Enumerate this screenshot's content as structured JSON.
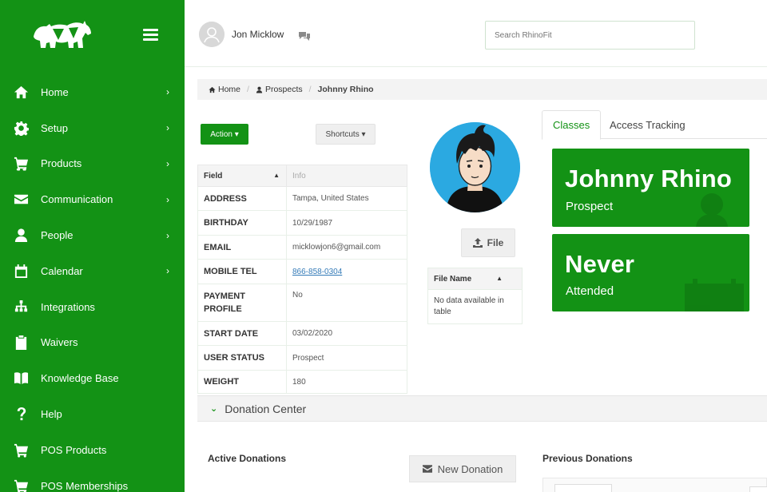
{
  "sidebar": {
    "menu_icon": "hamburger-icon",
    "items": [
      {
        "label": "Home",
        "icon": "home-icon",
        "chevron": true
      },
      {
        "label": "Setup",
        "icon": "gear-icon",
        "chevron": true
      },
      {
        "label": "Products",
        "icon": "cart-icon",
        "chevron": true
      },
      {
        "label": "Communication",
        "icon": "envelope-icon",
        "chevron": true
      },
      {
        "label": "People",
        "icon": "person-icon",
        "chevron": true
      },
      {
        "label": "Calendar",
        "icon": "calendar-icon",
        "chevron": true
      },
      {
        "label": "Integrations",
        "icon": "sitemap-icon",
        "chevron": false
      },
      {
        "label": "Waivers",
        "icon": "clipboard-icon",
        "chevron": false
      },
      {
        "label": "Knowledge Base",
        "icon": "book-icon",
        "chevron": false
      },
      {
        "label": "Help",
        "icon": "question-icon",
        "chevron": false
      },
      {
        "label": "POS Products",
        "icon": "cart-icon",
        "chevron": false
      },
      {
        "label": "POS Memberships",
        "icon": "cart-icon",
        "chevron": false
      }
    ],
    "chevron": "›"
  },
  "header": {
    "user_name": "Jon Micklow",
    "search_placeholder": "Search RhinoFit"
  },
  "breadcrumb": {
    "home": "Home",
    "prospects": "Prospects",
    "current": "Johnny Rhino",
    "sep": "/"
  },
  "actions": {
    "action_label": "Action ▾",
    "shortcuts_label": "Shortcuts ▾"
  },
  "fields": {
    "header_field": "Field",
    "header_sort": "▲",
    "header_info": "Info",
    "rows": [
      {
        "key": "ADDRESS",
        "value": "Tampa, United States"
      },
      {
        "key": "BIRTHDAY",
        "value": "10/29/1987"
      },
      {
        "key": "EMAIL",
        "value": "micklowjon6@gmail.com"
      },
      {
        "key": "MOBILE TEL",
        "value": "866-858-0304"
      },
      {
        "key": "PAYMENT PROFILE",
        "value": "No"
      },
      {
        "key": "START DATE",
        "value": "03/02/2020"
      },
      {
        "key": "USER STATUS",
        "value": "Prospect"
      },
      {
        "key": "WEIGHT",
        "value": "180"
      }
    ]
  },
  "files": {
    "button_label": "File",
    "header": "File Name",
    "header_sort": "▲",
    "empty": "No data available in table"
  },
  "tabs": {
    "classes": "Classes",
    "access": "Access Tracking"
  },
  "cards": {
    "name": "Johnny Rhino",
    "status": "Prospect",
    "last": "Never",
    "last_label": "Attended"
  },
  "donations": {
    "section": "Donation Center",
    "chevron": "⌄",
    "active": "Active Donations",
    "new_button": "New Donation",
    "previous": "Previous Donations"
  },
  "colors": {
    "brand": "#139215",
    "avatar_bg": "#2ba9e1"
  }
}
